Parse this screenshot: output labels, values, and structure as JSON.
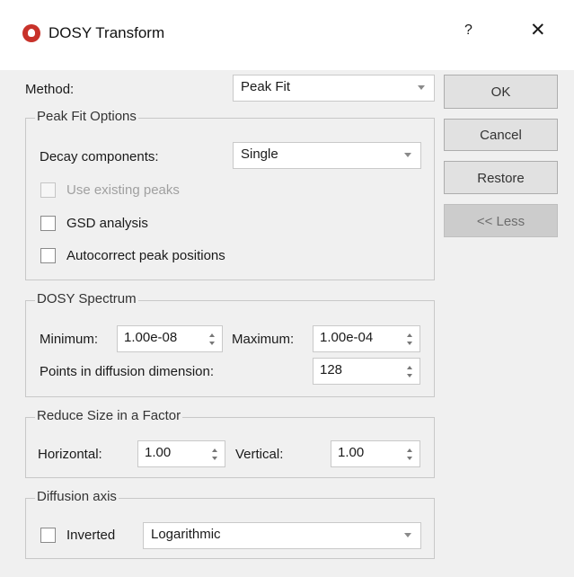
{
  "window": {
    "title": "DOSY Transform",
    "app_icon": "app-logo-icon",
    "help_glyph": "?",
    "close_glyph": "✕"
  },
  "method": {
    "label": "Method:",
    "value": "Peak Fit"
  },
  "buttons": {
    "ok": "OK",
    "cancel": "Cancel",
    "restore": "Restore",
    "less": "<< Less"
  },
  "peak_fit": {
    "title": "Peak Fit Options",
    "decay_label": "Decay components:",
    "decay_value": "Single",
    "use_existing_peaks": {
      "label": "Use existing peaks",
      "checked": false,
      "enabled": false
    },
    "gsd_analysis": {
      "label": "GSD analysis",
      "checked": false
    },
    "autocorrect": {
      "label": "Autocorrect peak positions",
      "checked": false
    }
  },
  "dosy_spectrum": {
    "title": "DOSY Spectrum",
    "minimum_label": "Minimum:",
    "minimum_value": "1.00e-08",
    "maximum_label": "Maximum:",
    "maximum_value": "1.00e-04",
    "points_label": "Points in diffusion dimension:",
    "points_value": "128"
  },
  "reduce_size": {
    "title": "Reduce Size in a Factor",
    "horizontal_label": "Horizontal:",
    "horizontal_value": "1.00",
    "vertical_label": "Vertical:",
    "vertical_value": "1.00"
  },
  "diffusion_axis": {
    "title": "Diffusion axis",
    "inverted": {
      "label": "Inverted",
      "checked": false
    },
    "scale_value": "Logarithmic"
  },
  "colors": {
    "accent": "#c8322a",
    "background": "#f0f0f0"
  }
}
